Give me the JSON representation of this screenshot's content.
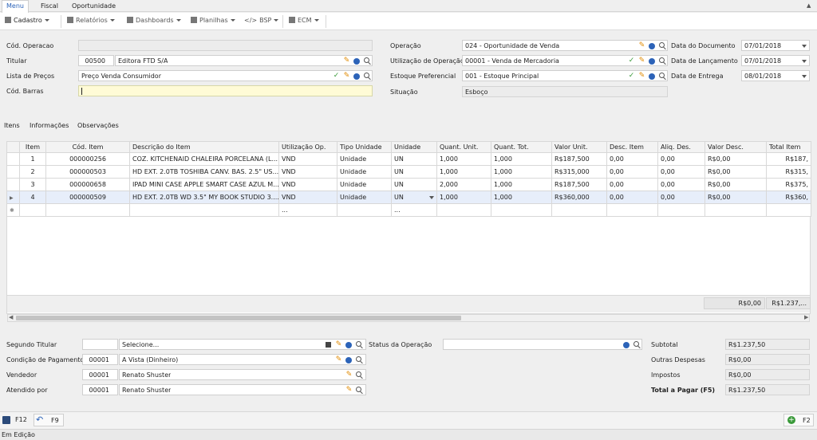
{
  "menu_tabs": [
    "Menu",
    "Fiscal",
    "Oportunidade"
  ],
  "toolbar": {
    "buttons": [
      {
        "label": "Cadastro",
        "icon": "list-icon"
      },
      {
        "label": "Relatórios",
        "icon": "report-icon"
      },
      {
        "label": "Dashboards",
        "icon": "dashboard-icon"
      },
      {
        "label": "Planilhas",
        "icon": "spreadsheet-icon"
      },
      {
        "label": "BSP",
        "icon": "code-icon"
      },
      {
        "label": "ECM",
        "icon": "ecm-icon"
      }
    ]
  },
  "form_left": {
    "cod_operacao_label": "Cód. Operacao",
    "cod_operacao_value": "",
    "titular_label": "Titular",
    "titular_code": "00500",
    "titular_name": "Editora FTD S/A",
    "lista_precos_label": "Lista de Preços",
    "lista_precos_value": "Preço Venda Consumidor",
    "cod_barras_label": "Cód. Barras",
    "cod_barras_value": ""
  },
  "form_mid": {
    "operacao_label": "Operação",
    "operacao_value": "024 - Oportunidade de Venda",
    "utilizacao_label": "Utilização de Operação",
    "utilizacao_value": "00001 - Venda de Mercadoria",
    "estoque_label": "Estoque Preferencial",
    "estoque_value": "001 - Estoque Principal",
    "situacao_label": "Situação",
    "situacao_value": "Esboço"
  },
  "form_right": {
    "data_documento_label": "Data do Documento",
    "data_documento_value": "07/01/2018",
    "data_lancamento_label": "Data de Lançamento",
    "data_lancamento_value": "07/01/2018",
    "data_entrega_label": "Data de Entrega",
    "data_entrega_value": "08/01/2018"
  },
  "section_tabs": [
    "Itens",
    "Informações",
    "Observações"
  ],
  "grid": {
    "columns": [
      "Item",
      "Cód. Item",
      "Descrição do Item",
      "Utilização Op.",
      "Tipo Unidade",
      "Unidade",
      "Quant. Unit.",
      "Quant. Tot.",
      "Valor Unit.",
      "Desc. Item",
      "Aliq. Des.",
      "Valor Desc.",
      "Total Item"
    ],
    "rows": [
      [
        "1",
        "000000256",
        "COZ. KITCHENAID CHALEIRA PORCELANA (L...",
        "VND",
        "Unidade",
        "UN",
        "1,000",
        "1,000",
        "R$187,500",
        "0,00",
        "0,00",
        "R$0,00",
        "R$187,"
      ],
      [
        "2",
        "000000503",
        "HD EXT. 2.0TB TOSHIBA CANV. BAS. 2.5\" US...",
        "VND",
        "Unidade",
        "UN",
        "1,000",
        "1,000",
        "R$315,000",
        "0,00",
        "0,00",
        "R$0,00",
        "R$315,"
      ],
      [
        "3",
        "000000658",
        "IPAD MINI CASE APPLE SMART CASE AZUL M...",
        "VND",
        "Unidade",
        "UN",
        "2,000",
        "1,000",
        "R$187,500",
        "0,00",
        "0,00",
        "R$0,00",
        "R$375,"
      ],
      [
        "4",
        "000000509",
        "HD EXT. 2.0TB WD 3.5\" MY BOOK STUDIO 3....",
        "VND",
        "Unidade",
        "UN",
        "1,000",
        "1,000",
        "R$360,000",
        "0,00",
        "0,00",
        "R$0,00",
        "R$360,"
      ]
    ],
    "new_row": [
      "",
      "",
      "",
      "...",
      "",
      "...",
      "",
      "",
      "",
      "",
      "",
      "",
      ""
    ],
    "footer_desc_total": "R$0,00",
    "footer_item_total": "R$1.237,..."
  },
  "bottom_left": {
    "segundo_titular_label": "Segundo Titular",
    "segundo_titular_code": "",
    "segundo_titular_value": "Selecione...",
    "condicao_label": "Condição de Pagamento",
    "condicao_code": "00001",
    "condicao_value": "A Vista (Dinheiro)",
    "vendedor_label": "Vendedor",
    "vendedor_code": "00001",
    "vendedor_value": "Renato Shuster",
    "atendido_label": "Atendido por",
    "atendido_code": "00001",
    "atendido_value": "Renato Shuster"
  },
  "status_operacao": {
    "label": "Status da Operação",
    "value": ""
  },
  "totals": {
    "subtotal_label": "Subtotal",
    "subtotal_value": "R$1.237,50",
    "outras_label": "Outras Despesas",
    "outras_value": "R$0,00",
    "impostos_label": "Impostos",
    "impostos_value": "R$0,00",
    "total_label": "Total a Pagar (F5)",
    "total_value": "R$1.237,50"
  },
  "action_bar": {
    "save_label": "F12",
    "undo_label": "F9",
    "add_label": "F2"
  },
  "status_bar": {
    "text": "Em Edição"
  },
  "colors": {
    "accent": "#2c63b8",
    "edit": "#e08a00",
    "ok": "#3b9b3b",
    "add": "#3a9a3a"
  }
}
